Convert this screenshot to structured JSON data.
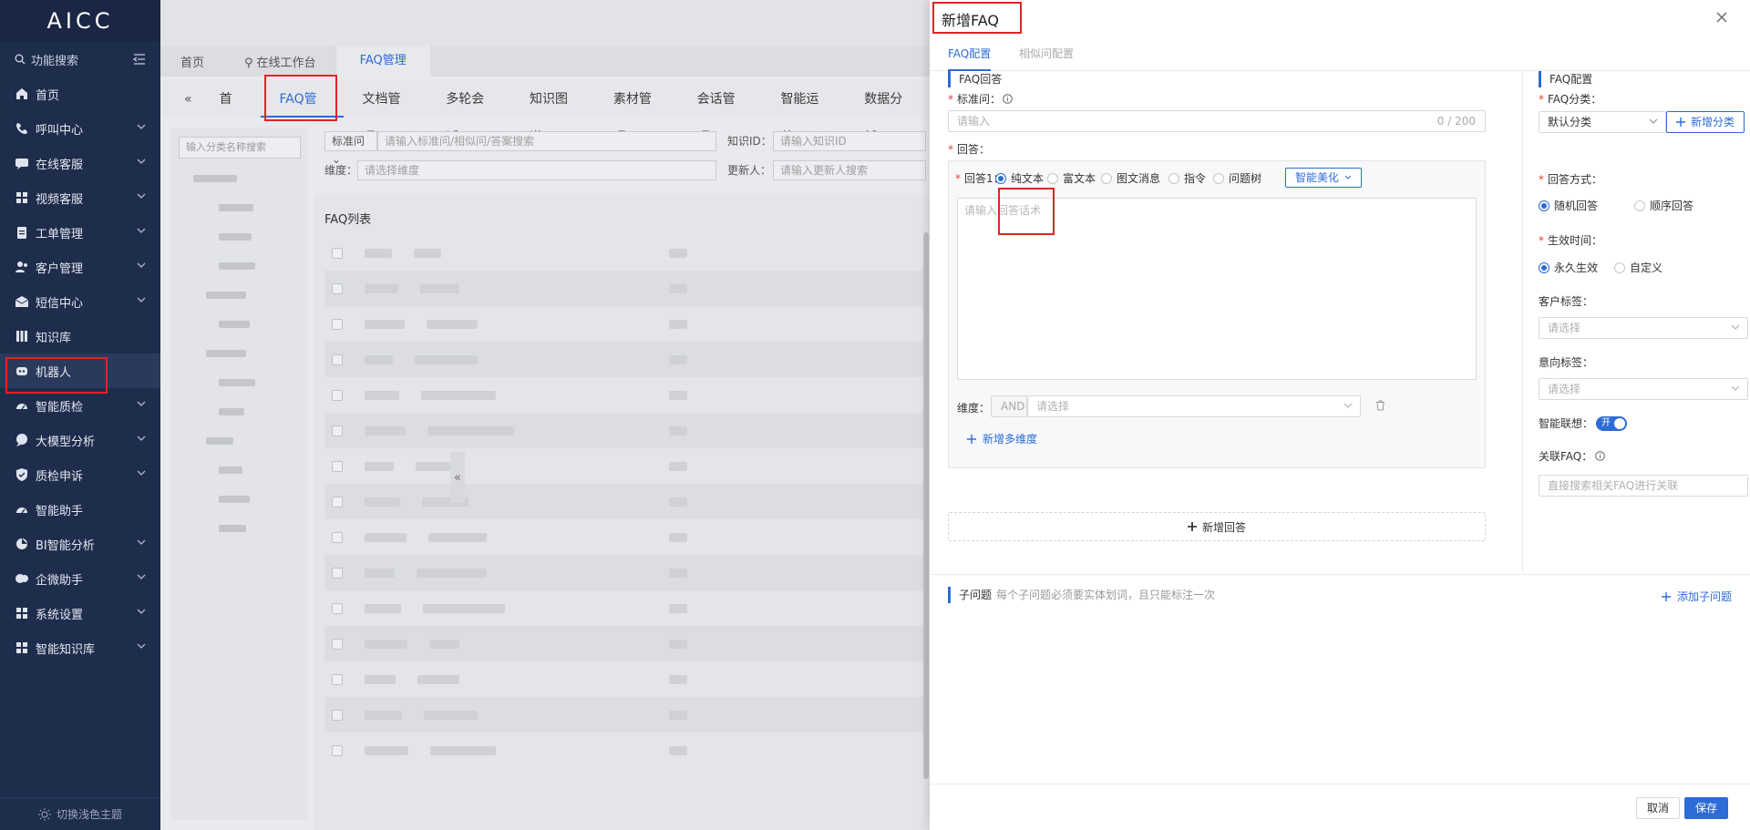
{
  "sidebar": {
    "logo": "AICC",
    "search_label": "功能搜索",
    "items": [
      {
        "label": "首页",
        "icon": "home-icon",
        "expandable": false
      },
      {
        "label": "呼叫中心",
        "icon": "phone-icon",
        "expandable": true
      },
      {
        "label": "在线客服",
        "icon": "chat-icon",
        "expandable": true
      },
      {
        "label": "视频客服",
        "icon": "grid-icon",
        "expandable": true
      },
      {
        "label": "工单管理",
        "icon": "clipboard-icon",
        "expandable": true
      },
      {
        "label": "客户管理",
        "icon": "users-icon",
        "expandable": true
      },
      {
        "label": "短信中心",
        "icon": "mail-icon",
        "expandable": true
      },
      {
        "label": "知识库",
        "icon": "library-icon",
        "expandable": false
      },
      {
        "label": "机器人",
        "icon": "robot-icon",
        "expandable": false,
        "active": true
      },
      {
        "label": "智能质检",
        "icon": "gauge-icon",
        "expandable": true
      },
      {
        "label": "大模型分析",
        "icon": "bubble-icon",
        "expandable": true
      },
      {
        "label": "质检申诉",
        "icon": "shield-icon",
        "expandable": true
      },
      {
        "label": "智能助手",
        "icon": "gauge-icon",
        "expandable": false
      },
      {
        "label": "BI智能分析",
        "icon": "pie-icon",
        "expandable": true
      },
      {
        "label": "企微助手",
        "icon": "bubbles-icon",
        "expandable": true
      },
      {
        "label": "系统设置",
        "icon": "grid-icon",
        "expandable": true
      },
      {
        "label": "智能知识库",
        "icon": "grid-icon",
        "expandable": true
      }
    ],
    "theme_toggle": "切换浅色主题"
  },
  "main": {
    "top_tabs": [
      "首页",
      "在线工作台",
      "FAQ管理"
    ],
    "module_tabs": [
      "首页",
      "FAQ管理",
      "文档管理",
      "多轮会话",
      "知识图谱",
      "素材管理",
      "会话管理",
      "智能运营",
      "数据分析"
    ],
    "tree_search_placeholder": "输入分类名称搜索",
    "filter": {
      "type_select": "标准问",
      "keyword_placeholder": "请输入标准问/相似问/答案搜索",
      "id_label": "知识ID：",
      "id_placeholder": "请输入知识ID",
      "dim_label": "维度：",
      "dim_placeholder": "请选择维度",
      "updater_label": "更新人：",
      "updater_placeholder": "请输入更新人搜索"
    },
    "list_title": "FAQ列表"
  },
  "drawer": {
    "title": "新增FAQ",
    "tabs": [
      "FAQ配置",
      "相似问配置"
    ],
    "answer_section": {
      "title": "FAQ回答",
      "std_question_label": "标准问：",
      "std_question_placeholder": "请输入",
      "std_question_counter": "0 / 200",
      "answer_label": "回答：",
      "answer1_label": "回答1：",
      "answer_types": [
        "纯文本",
        "富文本",
        "图文消息",
        "指令",
        "问题树"
      ],
      "selected_type_index": 0,
      "beautify_button": "智能美化",
      "answer_placeholder": "请输入回答话术",
      "dimension_label": "维度：",
      "dimension_op": "AND",
      "dimension_placeholder": "请选择",
      "add_dimension": "新增多维度",
      "add_answer": "新增回答"
    },
    "config_section": {
      "title": "FAQ配置",
      "category_label": "FAQ分类：",
      "category_value": "默认分类",
      "add_category": "新增分类",
      "answer_mode_label": "回答方式：",
      "answer_modes": [
        "随机回答",
        "顺序回答"
      ],
      "answer_mode_selected": 0,
      "effective_label": "生效时间：",
      "effective_options": [
        "永久生效",
        "自定义"
      ],
      "effective_selected": 0,
      "customer_tag_label": "客户标签：",
      "customer_tag_placeholder": "请选择",
      "intent_tag_label": "意向标签：",
      "intent_tag_placeholder": "请选择",
      "smart_assoc_label": "智能联想：",
      "smart_assoc_toggle": "开",
      "related_faq_label": "关联FAQ：",
      "related_faq_placeholder": "直接搜索相关FAQ进行关联"
    },
    "sub_question": {
      "title": "子问题",
      "hint": "每个子问题必须要实体划词，且只能标注一次",
      "add": "添加子问题"
    },
    "footer": {
      "cancel": "取消",
      "save": "保存"
    }
  },
  "colors": {
    "accent": "#2d6bd7",
    "sidebar": "#1f2d4d",
    "highlight": "#e02424",
    "required": "#e0413a"
  }
}
